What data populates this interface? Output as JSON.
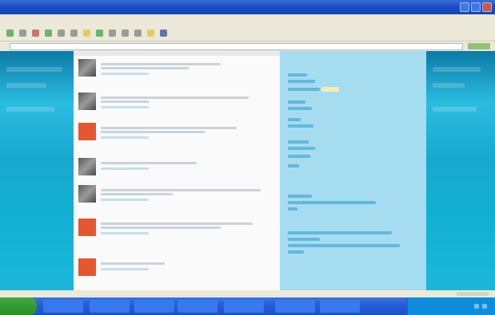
{
  "window": {
    "title": "",
    "buttons": [
      "minimize",
      "maximize",
      "close"
    ]
  },
  "menubar": {
    "items": [
      "",
      "",
      "",
      "",
      "",
      ""
    ]
  },
  "toolbar": {
    "buttons": [
      {
        "icon": "back-icon",
        "color": "#3a9a3a"
      },
      {
        "icon": "forward-icon",
        "color": "#7a7a7a"
      },
      {
        "icon": "stop-icon",
        "color": "#c04040"
      },
      {
        "icon": "refresh-icon",
        "color": "#3a9a3a"
      },
      {
        "icon": "home-icon",
        "color": "#7a7a7a"
      },
      {
        "icon": "search-icon",
        "color": "#7a7a7a"
      },
      {
        "icon": "favorites-icon",
        "color": "#e0c030"
      },
      {
        "icon": "history-icon",
        "color": "#3a9a3a"
      },
      {
        "icon": "mail-icon",
        "color": "#7a7a7a"
      },
      {
        "icon": "print-icon",
        "color": "#7a7a7a"
      },
      {
        "icon": "edit-icon",
        "color": "#7a7a7a"
      },
      {
        "icon": "discuss-icon",
        "color": "#e0c030"
      },
      {
        "icon": "messenger-icon",
        "color": "#2a3fa0"
      }
    ]
  },
  "address": {
    "label": "",
    "value": "",
    "go_label": ""
  },
  "feed": {
    "tweets": [
      {
        "avatar": "gray",
        "user": ""
      },
      {
        "avatar": "gray",
        "user": ""
      },
      {
        "avatar": "orange",
        "user": ""
      },
      {
        "avatar": "gray",
        "user": ""
      },
      {
        "avatar": "gray",
        "user": ""
      },
      {
        "avatar": "orange",
        "user": ""
      },
      {
        "avatar": "orange",
        "user": ""
      }
    ]
  },
  "panel": {
    "sections": [
      "",
      "",
      "",
      "",
      "",
      "",
      ""
    ]
  },
  "statusbar": {
    "text": ""
  },
  "taskbar": {
    "start_label": "",
    "tasks": [
      "",
      "",
      "",
      "",
      "",
      "",
      ""
    ],
    "clock": ""
  },
  "colors": {
    "accent": "#1fb3d8",
    "panel": "#a6dcf0",
    "avatar_orange": "#e5572e",
    "taskbar": "#245edb"
  }
}
